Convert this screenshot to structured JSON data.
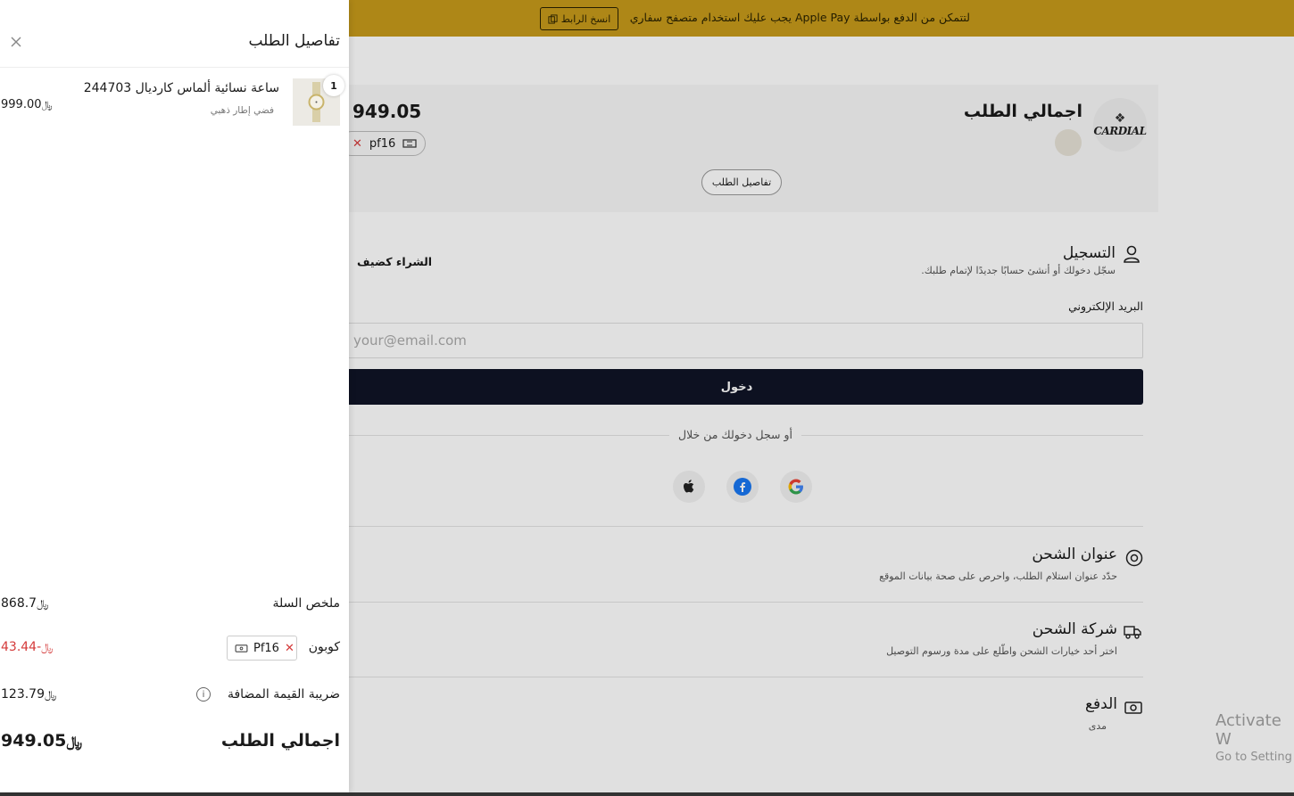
{
  "banner": {
    "text": "لتتمكن من الدفع بواسطة Apple Pay يجب عليك استخدام متصفح سفاري",
    "copy_link": "انسخ الرابط"
  },
  "summary": {
    "brand": "CARDIAL",
    "title": "اجمالي الطلب",
    "total": "949.05",
    "coupon": "pf16",
    "details_button": "تفاصيل الطلب"
  },
  "checkout": {
    "register": {
      "title": "التسجيل",
      "subtitle": "سجّل دخولك أو أنشئ حسابًا جديدًا لإتمام طلبك.",
      "guest": "الشراء كضيف"
    },
    "email_label": "البريد الإلكتروني",
    "email_placeholder": "your@email.com",
    "login_button": "دخول",
    "or_text": "أو سجل دخولك من خلال",
    "shipping_address": {
      "title": "عنوان الشحن",
      "subtitle": "حدّد عنوان استلام الطلب، واحرص على صحة بيانات الموقع"
    },
    "shipping_company": {
      "title": "شركة الشحن",
      "subtitle": "اختر أحد خيارات الشحن واطّلع على مدة ورسوم التوصيل"
    },
    "payment": {
      "title": "الدفع",
      "subtitle": "مدى"
    }
  },
  "drawer": {
    "title": "تفاصيل الطلب",
    "product": {
      "qty": "1",
      "name": "ساعة نسائية ألماس كارديال 244703",
      "variant": "فضي إطار ذهبي",
      "price": "999.00"
    },
    "cart_summary_label": "ملخص السلة",
    "cart_summary_value": "868.7",
    "coupon_label": "كوبون",
    "coupon_code": "Pf16",
    "coupon_value": "-43.44",
    "vat_label": "ضريبة القيمة المضافة",
    "vat_value": "123.79",
    "total_label": "اجمالي الطلب",
    "total_value": "949.05",
    "currency": "﷼"
  },
  "watermark": {
    "line1": "Activate W",
    "line2": "Go to Setting"
  },
  "colors": {
    "banner": "#c79a1b",
    "login_button": "#0f1426",
    "discount": "#d43a3a"
  }
}
